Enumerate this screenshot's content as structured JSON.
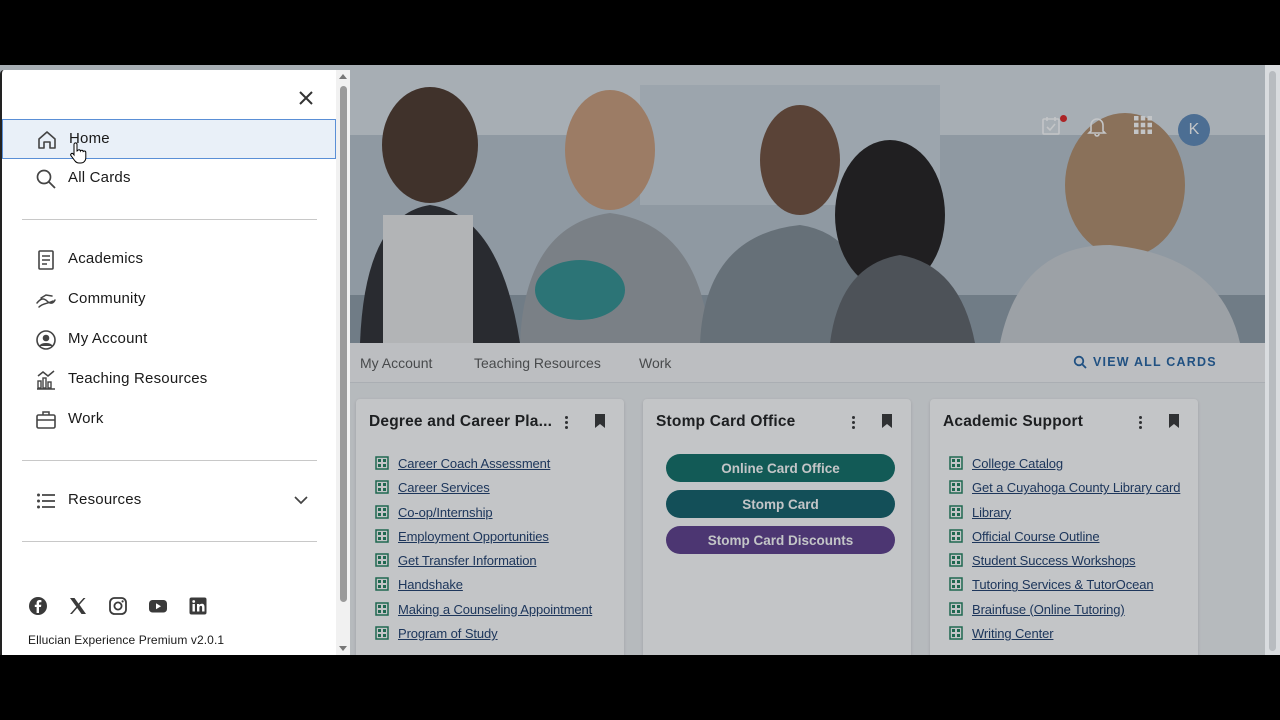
{
  "drawer": {
    "close_label": "×",
    "nav_primary": [
      {
        "label": "Home",
        "icon": "home-icon"
      },
      {
        "label": "All Cards",
        "icon": "search-icon"
      }
    ],
    "nav_categories": [
      {
        "label": "Academics",
        "icon": "book-icon"
      },
      {
        "label": "Community",
        "icon": "community-icon"
      },
      {
        "label": "My Account",
        "icon": "account-circle-icon"
      },
      {
        "label": "Teaching Resources",
        "icon": "chart-icon"
      },
      {
        "label": "Work",
        "icon": "briefcase-icon"
      }
    ],
    "resources_label": "Resources",
    "social_icons": [
      "facebook-icon",
      "x-icon",
      "instagram-icon",
      "youtube-icon",
      "linkedin-icon"
    ],
    "version": "Ellucian Experience Premium v2.0.1"
  },
  "header": {
    "avatar_initial": "K",
    "icons": [
      "tasks-icon",
      "bell-icon",
      "apps-grid-icon"
    ]
  },
  "tabs": [
    "My Account",
    "Teaching Resources",
    "Work"
  ],
  "view_all_label": "VIEW ALL CARDS",
  "cards": [
    {
      "title": "Degree and Career Pla...",
      "links": [
        "Career Coach Assessment",
        "Career Services",
        "Co-op/Internship",
        "Employment Opportunities",
        "Get Transfer Information",
        "Handshake",
        "Making a Counseling Appointment",
        "Program of Study"
      ]
    },
    {
      "title": "Stomp Card Office",
      "buttons": [
        {
          "label": "Online Card Office",
          "color": "#0b6b63"
        },
        {
          "label": "Stomp Card",
          "color": "#0c5c66"
        },
        {
          "label": "Stomp Card Discounts",
          "color": "#5a3a8a"
        }
      ]
    },
    {
      "title": "Academic Support",
      "links": [
        "College Catalog",
        "Get a Cuyahoga County Library card",
        "Library",
        "Official Course Outline",
        "Student Success Workshops",
        "Tutoring Services & TutorOcean",
        "Brainfuse (Online Tutoring)",
        "Writing Center"
      ]
    }
  ],
  "colors": {
    "accent_blue": "#1f5fa0",
    "link_icon_green": "#1d7f5a",
    "avatar_bg": "#5b87b7"
  }
}
